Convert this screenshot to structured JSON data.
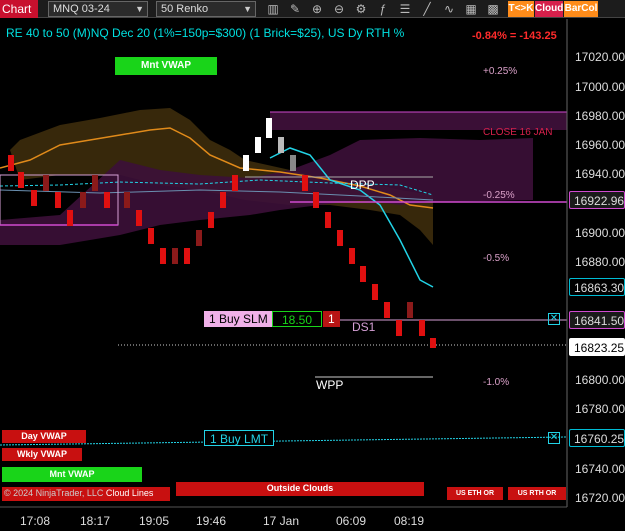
{
  "toolbar": {
    "chart_label": "Chart",
    "instrument": "MNQ 03-24",
    "bar_type": "50 Renko",
    "buttons": [
      {
        "label": "T<>K",
        "color": "#ff8c1a"
      },
      {
        "label": "Cloud",
        "color": "#d6204b"
      },
      {
        "label": "BarCol",
        "color": "#ff8c1a"
      }
    ]
  },
  "chart": {
    "title": "RE 40 to 50 (M)NQ Dec 20 (1%=150p=$300) (1 Brick=$25), US Dy RTH %",
    "pnl": "-0.84% = -143.25",
    "mnt_vwap_label": "Mnt VWAP",
    "close_label": "CLOSE 16 JAN",
    "dpp_label": "DPP",
    "ds1_label": "DS1",
    "wpp_label": "WPP",
    "percent_labels": [
      "+0.25%",
      "-0.25%",
      "-0.5%",
      "-1.0%"
    ],
    "buy_slm": {
      "label": "1 Buy SLM",
      "price": "18.50",
      "qty": "1"
    },
    "buy_lmt": {
      "label": "1 Buy LMT"
    },
    "copyright": "© 2024 NinjaTrader, LLC",
    "cloud_lines_label": "Cloud Lines",
    "bottom_tags": [
      "Day VWAP",
      "Wkly VWAP",
      "Mnt VWAP",
      "Outside Clouds",
      "US ETH OR",
      "US RTH OR"
    ]
  },
  "price_axis": {
    "labels": [
      "17020.00",
      "17000.00",
      "16980.00",
      "16960.00",
      "16940.00",
      "16900.00",
      "16880.00",
      "16800.00",
      "16780.00",
      "16740.00",
      "16720.00"
    ],
    "tags": [
      {
        "value": "16922.96",
        "bg": "#1a1a1a",
        "fg": "#ddd",
        "border": "#d04ad0"
      },
      {
        "value": "16863.30",
        "bg": "#000",
        "fg": "#ddd",
        "border": "#00bcd4"
      },
      {
        "value": "16841.50",
        "bg": "#1a1a1a",
        "fg": "#ddd",
        "border": "#d04ad0"
      },
      {
        "value": "16823.25",
        "bg": "#fff",
        "fg": "#000",
        "border": "#fff"
      },
      {
        "value": "16760.25",
        "bg": "#000",
        "fg": "#ddd",
        "border": "#00bcd4"
      }
    ]
  },
  "time_axis": [
    "17:08",
    "18:17",
    "19:05",
    "19:46",
    "17 Jan",
    "06:09",
    "08:19"
  ]
}
